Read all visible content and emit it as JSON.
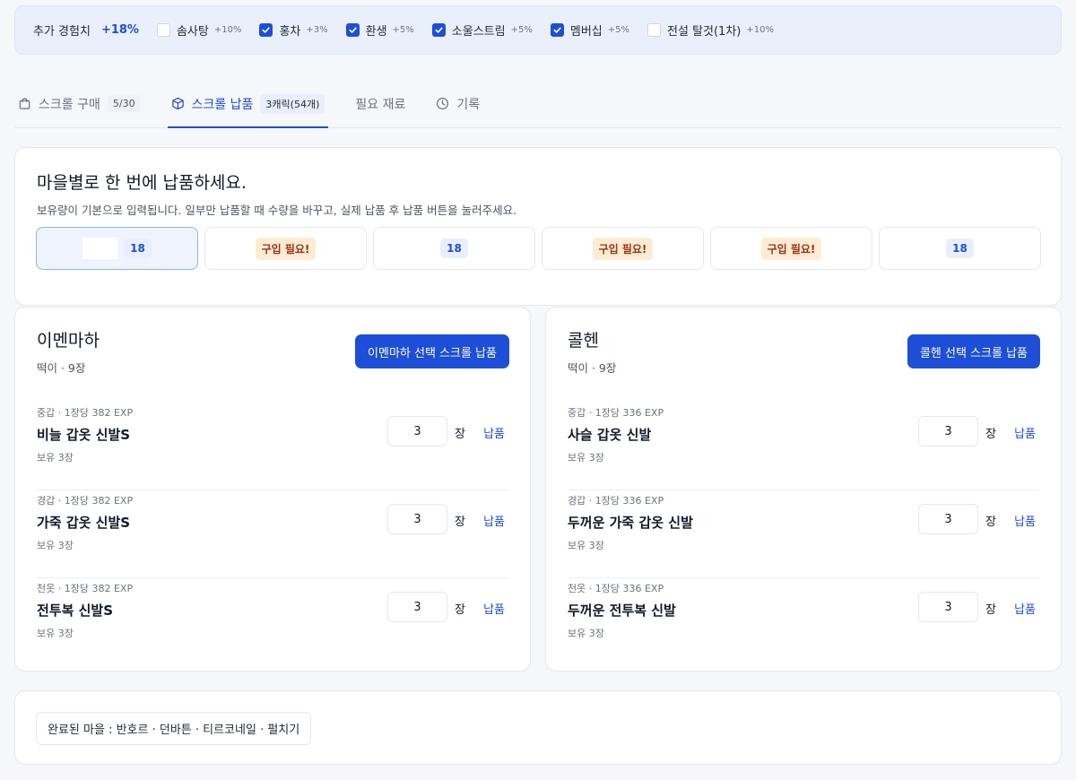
{
  "bonus": {
    "title": "추가 경험치",
    "total": "+18%",
    "options": [
      {
        "label": "솜사탕",
        "pct": "+10%",
        "checked": false
      },
      {
        "label": "홍차",
        "pct": "+3%",
        "checked": true
      },
      {
        "label": "환생",
        "pct": "+5%",
        "checked": true
      },
      {
        "label": "소울스트림",
        "pct": "+5%",
        "checked": true
      },
      {
        "label": "멤버십",
        "pct": "+5%",
        "checked": true
      },
      {
        "label": "전설 탈것(1차)",
        "pct": "+10%",
        "checked": false
      }
    ]
  },
  "tabs": [
    {
      "label": "스크롤 구매",
      "badge": "5/30",
      "icon": "bag-icon",
      "active": false
    },
    {
      "label": "스크롤 납품",
      "badge": "3캐릭(54개)",
      "icon": "box-icon",
      "active": true
    },
    {
      "label": "필요 재료",
      "badge": "",
      "icon": "",
      "active": false
    },
    {
      "label": "기록",
      "badge": "",
      "icon": "clock-icon",
      "active": false
    }
  ],
  "summary": {
    "title": "마을별로 한 번에 납품하세요.",
    "desc": "보유량이 기본으로 입력됩니다. 일부만 납품할 때 수량을 바꾸고, 실제 납품 후 납품 버튼을 눌러주세요.",
    "villages": [
      {
        "status": "18",
        "type": "count",
        "selected": true
      },
      {
        "status": "구입 필요!",
        "type": "need",
        "selected": false
      },
      {
        "status": "18",
        "type": "count",
        "selected": false
      },
      {
        "status": "구입 필요!",
        "type": "need",
        "selected": false
      },
      {
        "status": "구입 필요!",
        "type": "need",
        "selected": false
      },
      {
        "status": "18",
        "type": "count",
        "selected": false
      }
    ]
  },
  "panels": [
    {
      "name": "이멘마하",
      "sub": "떡이 · 9장",
      "button": "이멘마하 선택 스크롤 납품",
      "items": [
        {
          "meta": "중갑 · 1장당 382 EXP",
          "name": "비늘 갑옷 신발S",
          "own": "보유 3장",
          "qty": "3"
        },
        {
          "meta": "경갑 · 1장당 382 EXP",
          "name": "가죽 갑옷 신발S",
          "own": "보유 3장",
          "qty": "3"
        },
        {
          "meta": "천옷 · 1장당 382 EXP",
          "name": "전투복 신발S",
          "own": "보유 3장",
          "qty": "3"
        }
      ]
    },
    {
      "name": "콜헨",
      "sub": "떡이 · 9장",
      "button": "콜헨 선택 스크롤 납품",
      "items": [
        {
          "meta": "중갑 · 1장당 336 EXP",
          "name": "사슬 갑옷 신발",
          "own": "보유 3장",
          "qty": "3"
        },
        {
          "meta": "경갑 · 1장당 336 EXP",
          "name": "두꺼운 가죽 갑옷 신발",
          "own": "보유 3장",
          "qty": "3"
        },
        {
          "meta": "천옷 · 1장당 336 EXP",
          "name": "두꺼운 전투복 신발",
          "own": "보유 3장",
          "qty": "3"
        }
      ]
    }
  ],
  "labels": {
    "unit": "장",
    "deliver": "납품"
  },
  "done": "완료된 마을 : 반호르 · 던바튼 · 티르코네일 · 펄치기"
}
